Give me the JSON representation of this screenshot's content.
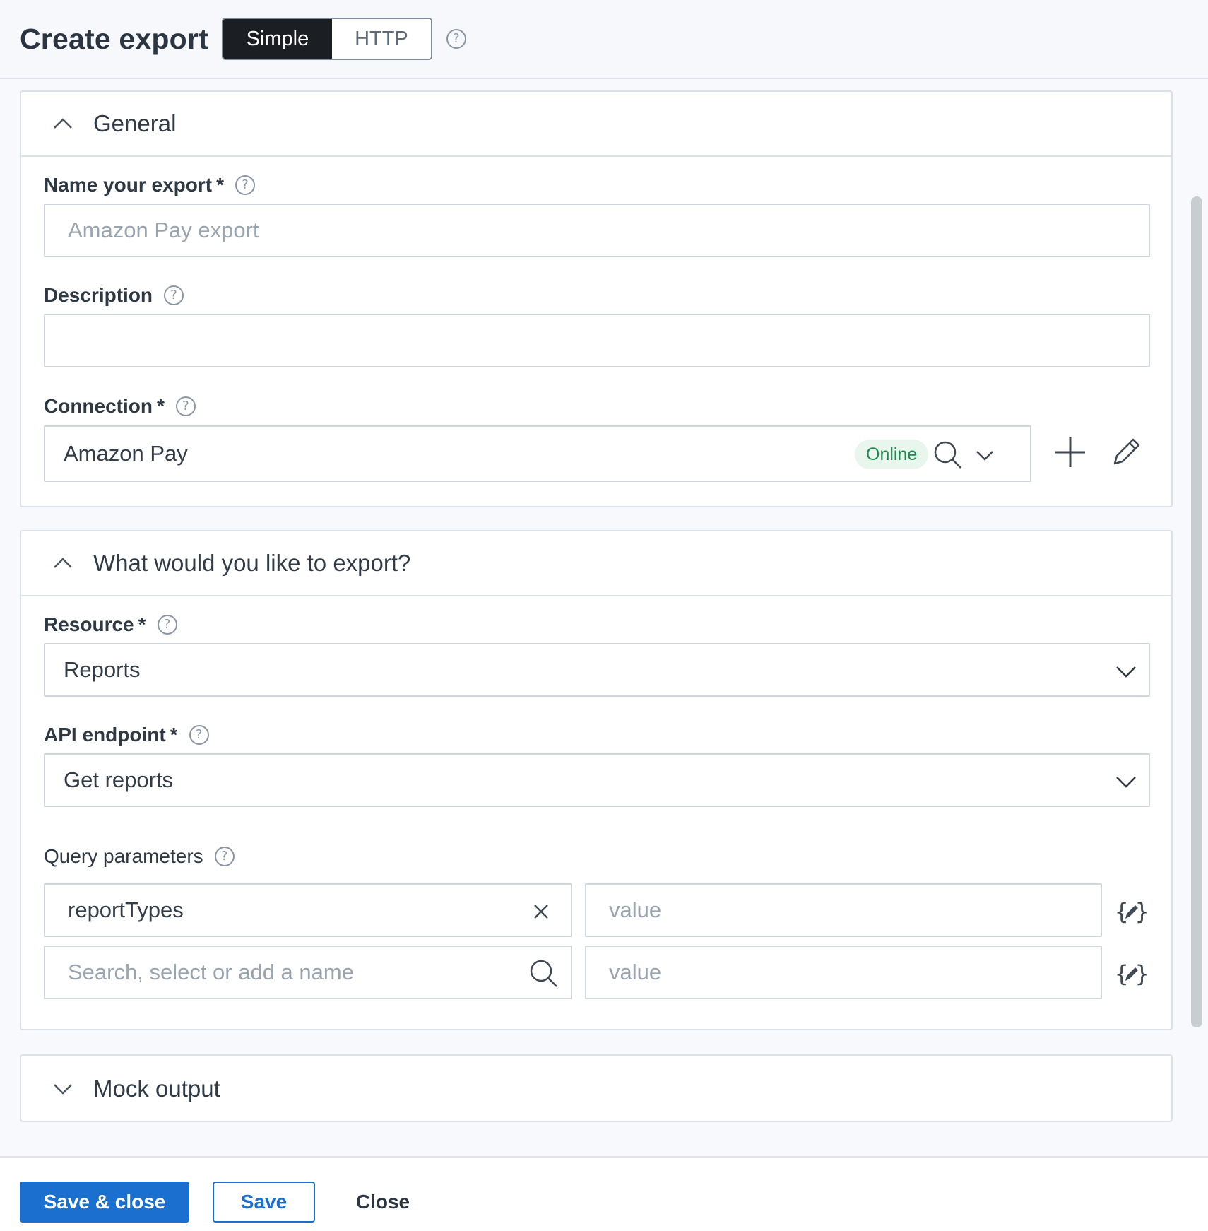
{
  "header": {
    "title": "Create export",
    "toggle": {
      "simple": "Simple",
      "http": "HTTP",
      "selected": "Simple"
    },
    "help_icon": "help-icon"
  },
  "general": {
    "section_title": "General",
    "name_label": "Name your export",
    "name_placeholder": "Amazon Pay export",
    "name_value": "",
    "description_label": "Description",
    "description_value": "",
    "connection_label": "Connection",
    "connection_value": "Amazon Pay",
    "connection_status": "Online",
    "required_mark": "*"
  },
  "export_section": {
    "section_title": "What would you like to export?",
    "resource_label": "Resource",
    "resource_value": "Reports",
    "endpoint_label": "API endpoint",
    "endpoint_value": "Get reports",
    "query_label": "Query parameters",
    "query_rows": [
      {
        "name": "reportTypes",
        "value_placeholder": "value"
      },
      {
        "name_placeholder": "Search, select or add a name",
        "value_placeholder": "value"
      }
    ]
  },
  "mock": {
    "section_title": "Mock output"
  },
  "footer": {
    "save_close": "Save & close",
    "save": "Save",
    "close": "Close"
  },
  "colors": {
    "primary": "#1a6fcf",
    "online_text": "#1d8a4f",
    "online_bg": "#e8f6ee",
    "toggle_active": "#1b1f23"
  }
}
